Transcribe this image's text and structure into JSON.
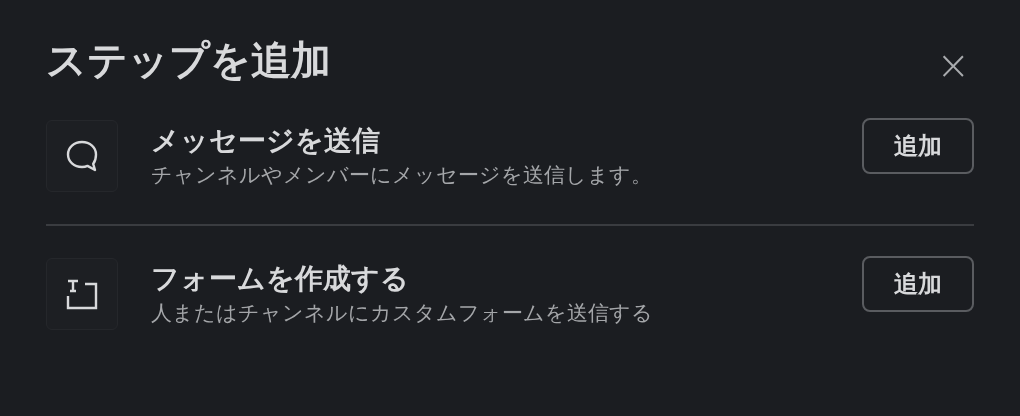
{
  "dialog": {
    "title": "ステップを追加",
    "close": "×"
  },
  "steps": [
    {
      "kind": "message",
      "title": "メッセージを送信",
      "description": "チャンネルやメンバーにメッセージを送信します。",
      "button": "追加"
    },
    {
      "kind": "form",
      "title": "フォームを作成する",
      "description": "人またはチャンネルにカスタムフォームを送信する",
      "button": "追加"
    }
  ]
}
